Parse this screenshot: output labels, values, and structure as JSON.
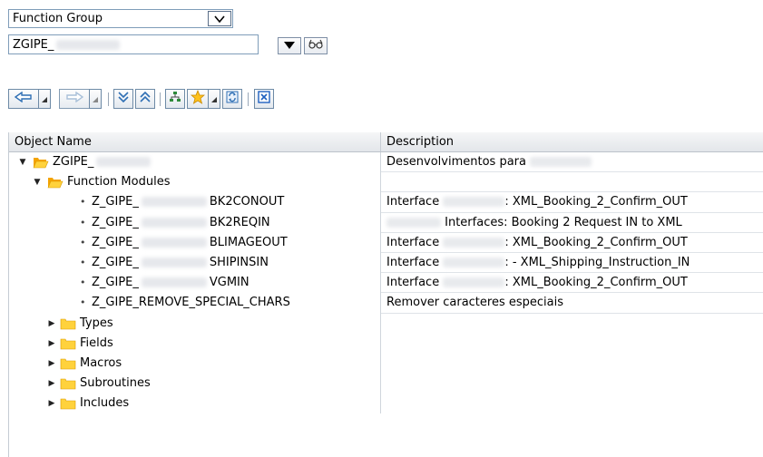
{
  "object_type": {
    "selected": "Function Group",
    "dropdown_icon": "chevron-down-icon"
  },
  "object_name": {
    "value": "ZGIPE_",
    "dropdown_icon": "triangle-down-icon",
    "search_icon": "glasses-icon"
  },
  "toolbar": {
    "buttons": [
      "back",
      "forward",
      "expand-all",
      "collapse-all",
      "hierarchy",
      "favorites",
      "refresh",
      "close"
    ]
  },
  "tree": {
    "columns": [
      "Object Name",
      "Description"
    ],
    "root": {
      "label": "ZGIPE_",
      "description": "Desenvolvimentos para"
    },
    "function_modules_label": "Function Modules",
    "modules": [
      {
        "prefix": "Z_GIPE_",
        "suffix": "BK2CONOUT",
        "desc_pre": "Interface",
        "desc_post": ": XML_Booking_2_Confirm_OUT"
      },
      {
        "prefix": "Z_GIPE_",
        "suffix": "BK2REQIN",
        "desc_pre": "",
        "desc_post": "Interfaces: Booking 2 Request IN to XML"
      },
      {
        "prefix": "Z_GIPE_",
        "suffix": "BLIMAGEOUT",
        "desc_pre": "Interface",
        "desc_post": ": XML_Booking_2_Confirm_OUT"
      },
      {
        "prefix": "Z_GIPE_",
        "suffix": "SHIPINSIN",
        "desc_pre": "Interface",
        "desc_post": ": - XML_Shipping_Instruction_IN"
      },
      {
        "prefix": "Z_GIPE_",
        "suffix": "VGMIN",
        "desc_pre": "Interface",
        "desc_post": ": XML_Booking_2_Confirm_OUT"
      }
    ],
    "last_module": {
      "label": "Z_GIPE_REMOVE_SPECIAL_CHARS",
      "description": "Remover caracteres especiais"
    },
    "folders": [
      "Types",
      "Fields",
      "Macros",
      "Subroutines",
      "Includes"
    ]
  },
  "colors": {
    "folder_fill": "#ffd23c",
    "folder_open": "#ffc21d",
    "toolbar_arrow": "#2f6fb4",
    "close_blue": "#1e60c0"
  }
}
